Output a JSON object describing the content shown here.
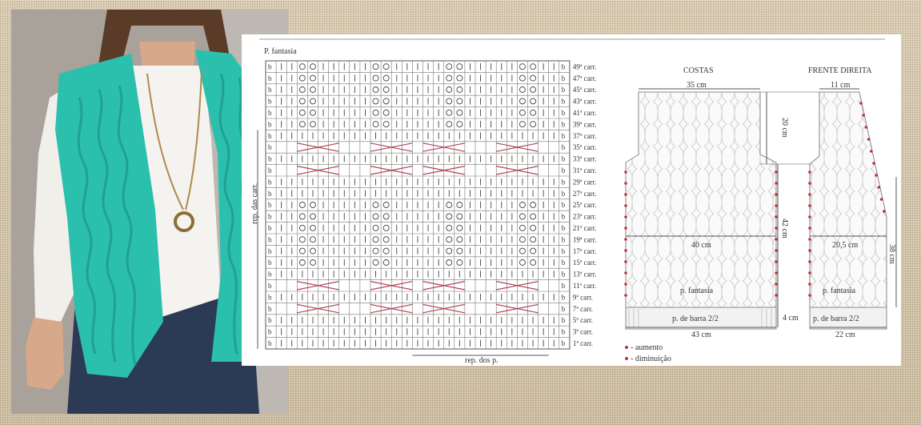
{
  "chart": {
    "title": "P. fantasia",
    "y_axis_label": "rep. das carr.",
    "x_repeat_label": "rep. dos p.",
    "edge_symbol": "b",
    "row_labels": [
      "49ª carr.",
      "47ª carr.",
      "45ª carr.",
      "43ª carr.",
      "41ª carr.",
      "39ª carr.",
      "37ª carr.",
      "35ª carr.",
      "33ª carr.",
      "31ª carr.",
      "29ª carr.",
      "27ª carr.",
      "25ª carr.",
      "23ª carr.",
      "21ª carr.",
      "19ª carr.",
      "17ª carr.",
      "15ª carr.",
      "13ª carr.",
      "11ª carr.",
      "9ª carr.",
      "7ª carr.",
      "5ª carr.",
      "3ª carr.",
      "1ª carr."
    ]
  },
  "schematic": {
    "back_title": "COSTAS",
    "front_title": "FRENTE DIREITA",
    "back_top_width": "35 cm",
    "back_armhole_height": "20 cm",
    "back_body_height": "42 cm",
    "back_chest_width": "40 cm",
    "back_stitch": "p. fantasia",
    "back_rib": "p. de barra 2/2",
    "back_bottom_width": "43 cm",
    "rib_height": "4 cm",
    "front_top_width": "11 cm",
    "front_chest_width": "20,5 cm",
    "front_height": "38 cm",
    "front_stitch": "p. fantasia",
    "front_rib": "p. de barra 2/2",
    "front_bottom_width": "22 cm"
  },
  "legend": {
    "increase": "- aumento",
    "decrease": "- diminuição"
  },
  "colors": {
    "background": "#d9ccb4",
    "vest": "#2bbfae",
    "cable_cross": "#b0475a",
    "marker": "#c0303a"
  }
}
